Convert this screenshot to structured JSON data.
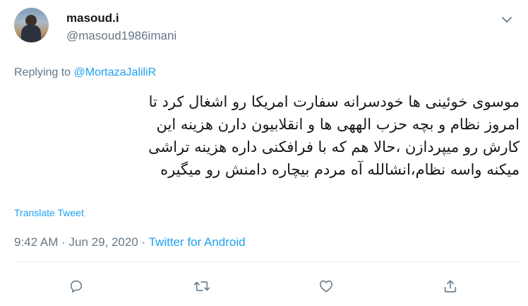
{
  "user": {
    "display_name": "masoud.i",
    "handle": "@masoud1986imani"
  },
  "reply": {
    "prefix": "Replying to ",
    "to_handle": "@MortazaJaliliR"
  },
  "tweet": {
    "lines": [
      "موسوی خوئینی ها خودسرانه سفارت امریکا رو اشغال کرد تا",
      "امروز نظام و بچه حزب الههی ها و انقلابیون دارن هزینه این",
      "کارش رو میپردازن ،حالا هم که با فرافکنی داره هزینه تراشی",
      "میکنه واسه نظام،انشالله آه مردم بیچاره دامنش رو میگیره"
    ]
  },
  "translate_label": "Translate Tweet",
  "meta": {
    "time": "9:42 AM",
    "separator1": " · ",
    "date": "Jun 29, 2020",
    "separator2": " · ",
    "source": "Twitter for Android"
  },
  "icons": {
    "more": "chevron-down-icon",
    "reply": "reply-icon",
    "retweet": "retweet-icon",
    "like": "like-icon",
    "share": "share-icon"
  },
  "colors": {
    "link": "#1da1f2",
    "secondary_text": "#657786",
    "primary_text": "#14171a"
  }
}
